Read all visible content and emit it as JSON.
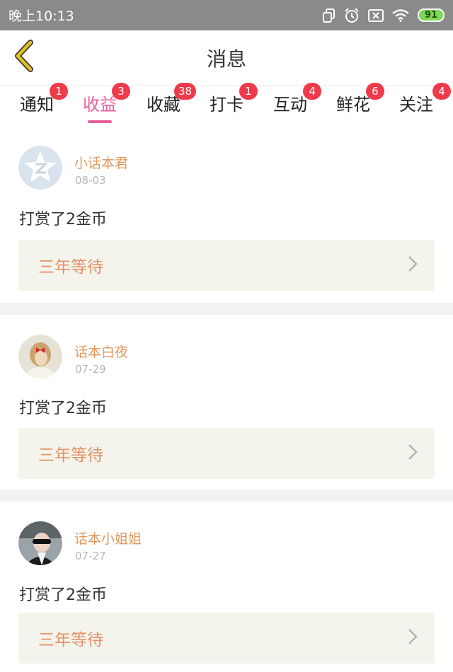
{
  "status_bar": {
    "time": "晚上10:13",
    "battery": "91",
    "icons": [
      "copy-icon",
      "alarm-icon",
      "sim-x-icon",
      "wifi-icon",
      "battery-icon"
    ]
  },
  "header": {
    "title": "消息",
    "back_icon": "chevron-left-icon",
    "accent": "#e6c21a"
  },
  "tabs": [
    {
      "label": "通知",
      "badge": "1",
      "active": false
    },
    {
      "label": "收益",
      "badge": "3",
      "active": true
    },
    {
      "label": "收藏",
      "badge": "38",
      "active": false
    },
    {
      "label": "打卡",
      "badge": "1",
      "active": false
    },
    {
      "label": "互动",
      "badge": "4",
      "active": false
    },
    {
      "label": "鲜花",
      "badge": "6",
      "active": false
    },
    {
      "label": "关注",
      "badge": "4",
      "active": false
    }
  ],
  "colors": {
    "active_tab": "#e8609b",
    "badge": "#ef3a4a",
    "username": "#e3975a",
    "link_text": "#e59266",
    "link_bg": "#f4f3ec"
  },
  "messages": [
    {
      "username": "小话本君",
      "date": "08-03",
      "action": "打赏了2金币",
      "link": "三年等待",
      "avatar": "default-avatar"
    },
    {
      "username": "话本白夜",
      "date": "07-29",
      "action": "打赏了2金币",
      "link": "三年等待",
      "avatar": "girl-photo-avatar"
    },
    {
      "username": "话本小姐姐",
      "date": "07-27",
      "action": "打赏了2金币",
      "link": "三年等待",
      "avatar": "sunglasses-photo-avatar"
    }
  ]
}
